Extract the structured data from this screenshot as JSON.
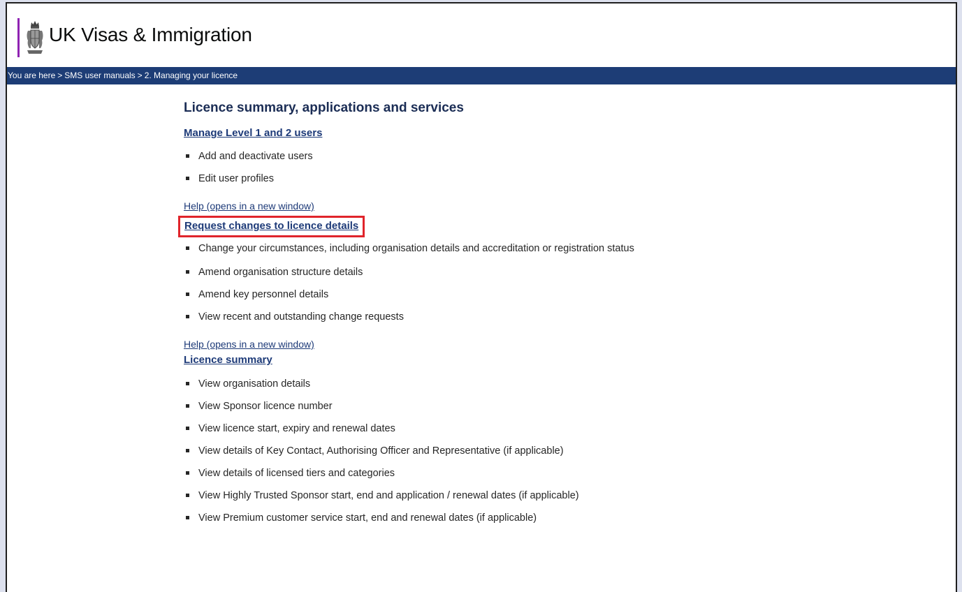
{
  "header": {
    "title": "UK Visas & Immigration",
    "brand_color": "#8f23b3",
    "logo_icon": "royal-crest-icon"
  },
  "breadcrumb": {
    "items": [
      "You are here",
      "SMS user manuals",
      "2. Managing your licence"
    ],
    "separator": ">",
    "background": "#1d3d76"
  },
  "page": {
    "title": "Licence summary, applications and services"
  },
  "sections": [
    {
      "heading": "Manage Level 1 and 2 users",
      "items": [
        "Add and deactivate users",
        "Edit user profiles"
      ],
      "help": "Help (opens in a new window)"
    },
    {
      "heading": "Request changes to licence details",
      "highlighted": true,
      "items": [
        "Change your circumstances, including organisation details and accreditation or registration status",
        "Amend organisation structure details",
        "Amend key personnel details",
        "View recent and outstanding change requests"
      ],
      "help": "Help (opens in a new window)"
    },
    {
      "heading": "Licence summary",
      "items": [
        "View organisation details",
        "View Sponsor licence number",
        "View licence start, expiry and renewal dates",
        "View details of Key Contact, Authorising Officer and Representative (if applicable)",
        "View details of licensed tiers and categories",
        "View Highly Trusted Sponsor start, end and application / renewal dates (if applicable)",
        "View Premium customer service start, end and renewal dates (if applicable)"
      ]
    }
  ],
  "colors": {
    "link": "#1d3a78",
    "highlight_border": "#e0242b"
  }
}
